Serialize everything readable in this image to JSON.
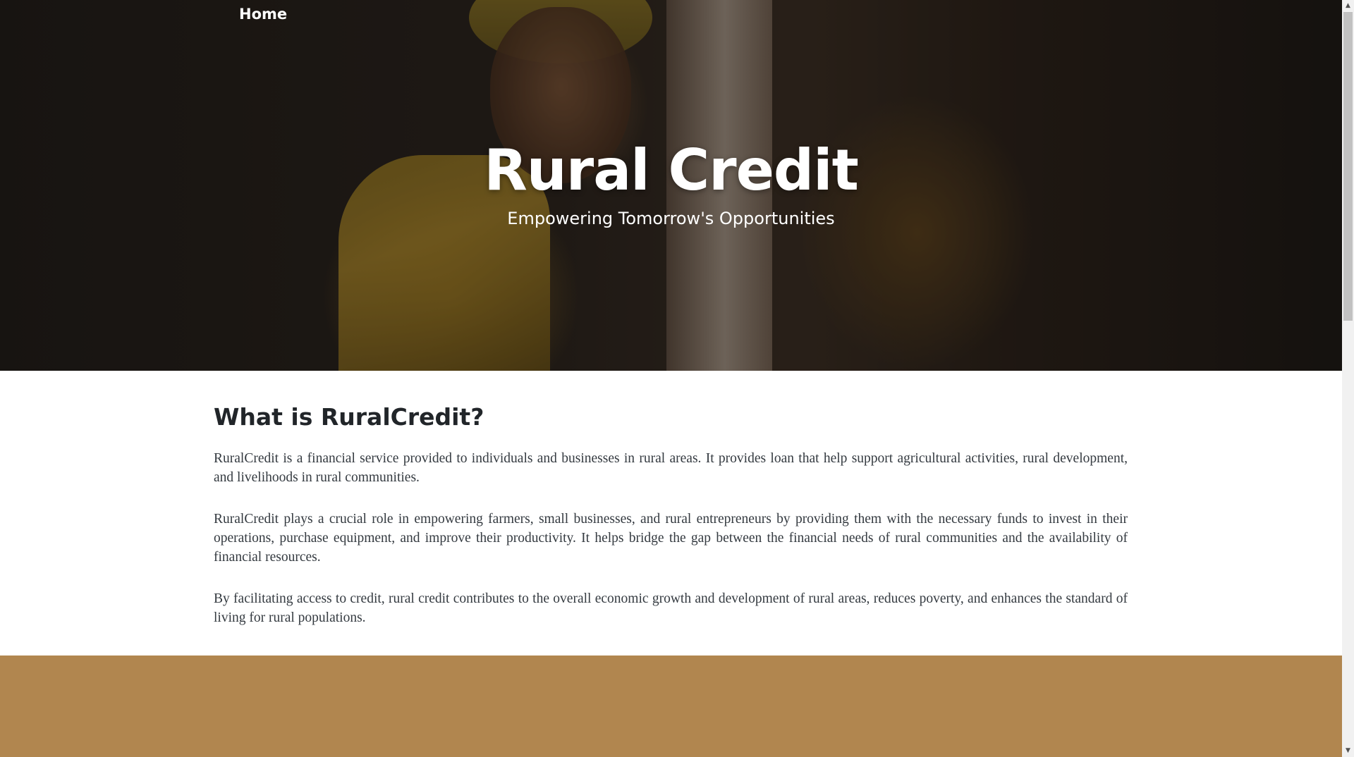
{
  "nav": {
    "home_label": "Home"
  },
  "hero": {
    "title": "Rural Credit",
    "subtitle": "Empowering Tomorrow's Opportunities"
  },
  "about": {
    "heading": "What is RuralCredit?",
    "paragraphs": [
      "RuralCredit is a financial service provided to individuals and businesses in rural areas. It provides loan that help support agricultural activities, rural development, and livelihoods in rural communities.",
      "RuralCredit plays a crucial role in empowering farmers, small businesses, and rural entrepreneurs by providing them with the necessary funds to invest in their operations, purchase equipment, and improve their productivity. It helps bridge the gap between the financial needs of rural communities and the availability of financial resources.",
      "By facilitating access to credit, rural credit contributes to the overall economic growth and development of rural areas, reduces poverty, and enhances the standard of living for rural populations."
    ]
  },
  "scrollbar": {
    "up_icon": "▲",
    "down_icon": "▼"
  },
  "colors": {
    "band": "#b1864f",
    "heading_text": "#212529",
    "body_text": "#343a40"
  }
}
